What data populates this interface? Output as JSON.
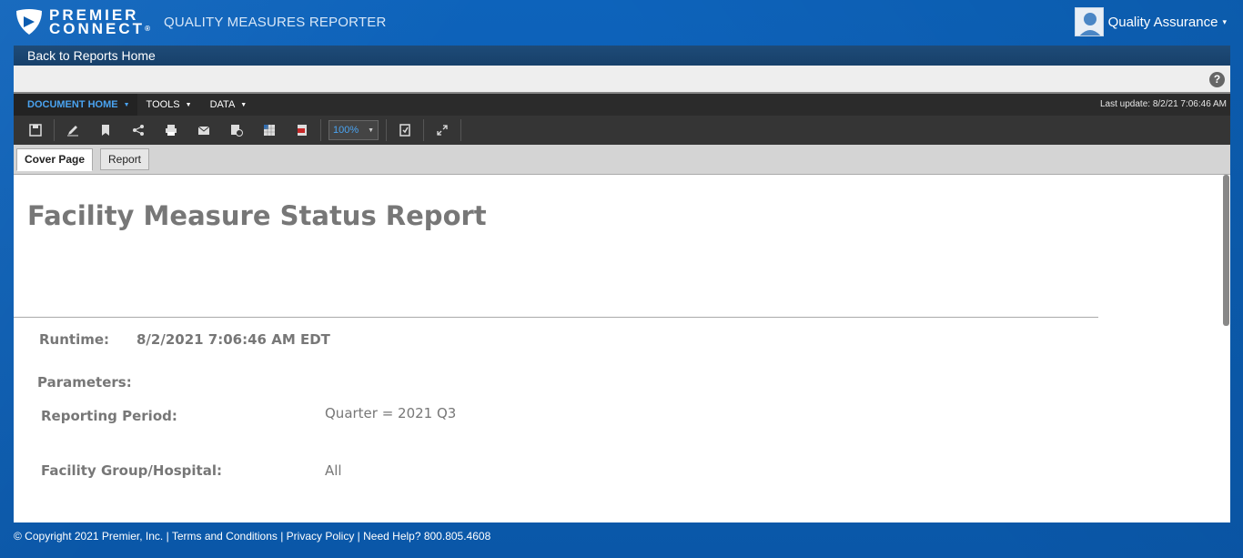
{
  "header": {
    "logo_line1": "PREMIER",
    "logo_line2": "CONNECT",
    "logo_reg": "®",
    "app_title": "QUALITY MEASURES REPORTER",
    "user_name": "Quality Assurance",
    "user_caret": "▾"
  },
  "nav": {
    "back_link": "Back to Reports Home",
    "help_glyph": "?"
  },
  "menu": {
    "items": [
      {
        "label": "DOCUMENT HOME",
        "caret": "▼"
      },
      {
        "label": "TOOLS",
        "caret": "▼"
      },
      {
        "label": "DATA",
        "caret": "▼"
      }
    ],
    "last_update": "Last update: 8/2/21 7:06:46 AM"
  },
  "toolbar": {
    "icons": [
      "save-icon",
      "edit-icon",
      "bookmark-icon",
      "share-icon",
      "print-icon",
      "email-icon",
      "schedule-icon",
      "export-excel-icon",
      "export-pdf-icon",
      "refresh-icon",
      "fullscreen-icon"
    ],
    "zoom_value": "100%",
    "zoom_caret": "▼"
  },
  "tabs": [
    {
      "label": "Cover Page",
      "active": true
    },
    {
      "label": "Report",
      "active": false
    }
  ],
  "report": {
    "title": "Facility Measure Status Report",
    "runtime_label": "Runtime:",
    "runtime_value": "8/2/2021 7:06:46 AM EDT",
    "parameters_label": "Parameters:",
    "reporting_period_label": "Reporting Period:",
    "reporting_period_value": "Quarter = 2021 Q3",
    "facility_label": "Facility Group/Hospital:",
    "facility_value": "All"
  },
  "footer": {
    "text": "© Copyright 2021 Premier, Inc. | Terms and Conditions | Privacy Policy | Need Help? 800.805.4608"
  },
  "colors": {
    "background": "#0b5cb0",
    "menu_active": "#4aa3f0",
    "title_gray": "#777777",
    "back_bar": "#1e4b78"
  }
}
